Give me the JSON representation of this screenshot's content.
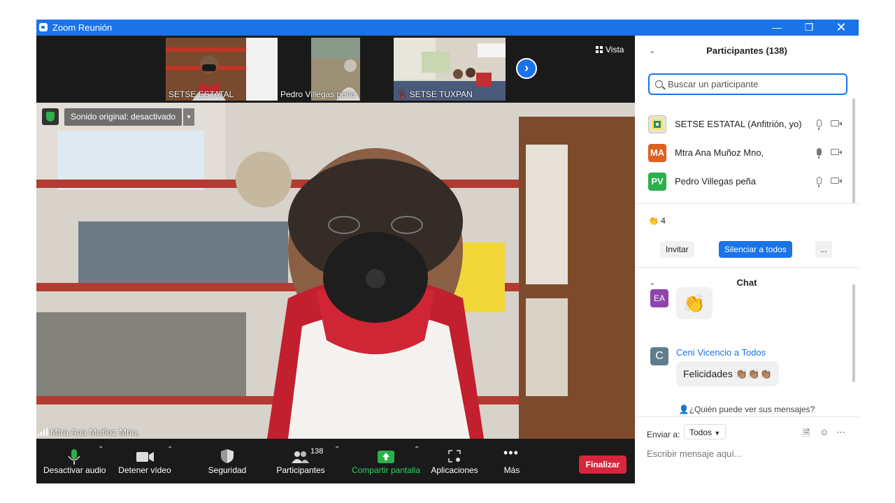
{
  "titlebar": {
    "title": "Zoom Reunión"
  },
  "thumbnails": [
    {
      "name": "SETSE ESTATAL"
    },
    {
      "name": "Pedro Villegas peña"
    },
    {
      "name": "SETSE TUXPAN"
    }
  ],
  "view": {
    "label": "Vista"
  },
  "main_video": {
    "sound_label": "Sonido original: desactivado",
    "speaker_name": "Mtra Ana Muñoz Mno,"
  },
  "toolbar": {
    "audio_label": "Desactivar audio",
    "video_label": "Detener vídeo",
    "security_label": "Seguridad",
    "participants_label": "Participantes",
    "participants_count": "138",
    "share_label": "Compartir pantalla",
    "apps_label": "Aplicaciones",
    "more_label": "Más",
    "end_label": "Finalizar"
  },
  "participants_panel": {
    "title": "Participantes (138)",
    "search_placeholder": "Buscar un participante",
    "participants": [
      {
        "initials": "",
        "name": "SETSE ESTATAL (Anfitrión, yo)",
        "avatar_color": "#e8e4d8"
      },
      {
        "initials": "MA",
        "name": "Mtra Ana Muñoz Mno,",
        "avatar_color": "#e0601f"
      },
      {
        "initials": "PV",
        "name": "Pedro Villegas peña",
        "avatar_color": "#2bb04a"
      }
    ],
    "reaction_count": "4",
    "invite_label": "Invitar",
    "mute_all_label": "Silenciar a todos",
    "more_label": "..."
  },
  "chat_panel": {
    "title": "Chat",
    "messages": [
      {
        "initials": "EA",
        "avatar_color": "#8e44ad",
        "text": "👏"
      },
      {
        "initials": "C",
        "avatar_color": "#5f7d8c",
        "sender": "Ceni Vicencio a Todos",
        "text": "Felicidades 👏🏽👏🏽👏🏽"
      }
    ],
    "who_can_see": "¿Quién puede ver sus mensajes?",
    "send_to_label": "Enviar a:",
    "send_to_value": "Todos",
    "input_placeholder": "Escribir mensaje aquí..."
  }
}
